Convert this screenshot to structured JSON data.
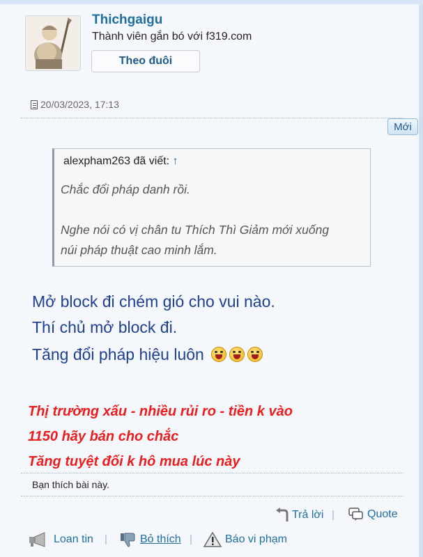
{
  "author": {
    "username": "Thichgaigu",
    "title": "Thành viên gắn bó với f319.com",
    "follow_label": "Theo đuôi"
  },
  "post": {
    "timestamp": "20/03/2023, 17:13",
    "new_badge": "Mới"
  },
  "quote": {
    "author_text": "alexpham263 đã viết:",
    "arrow": "↑",
    "lines": [
      "Chắc đổi pháp danh rồi.",
      "Nghe nói có vị chân tu Thích Thì Giảm mới xuống",
      "núi pháp thuật cao minh lắm."
    ]
  },
  "message": {
    "lines": [
      "Mở block đi chém gió cho vui nào.",
      "Thí chủ mở block đi.",
      "Tăng đổi pháp hiệu luôn"
    ],
    "emoji_count": 3
  },
  "signature": {
    "lines": [
      "Thị trường xấu - nhiều rủi ro - tiền k vào",
      "1150 hãy bán cho chắc",
      "Tăng tuyệt đối k hô mua lúc này"
    ]
  },
  "likes": {
    "text": "Bạn thích bài này."
  },
  "actions": {
    "reply_label": "Trả lời",
    "quote_label": "Quote",
    "spread_label": "Loan tin",
    "unlike_label": "Bỏ thích",
    "report_label": "Báo vi phạm"
  },
  "colors": {
    "link": "#1f6e9e",
    "message_text": "#1f3f8f",
    "signature_text": "#ee1d1d",
    "background": "#f4f8fd"
  }
}
